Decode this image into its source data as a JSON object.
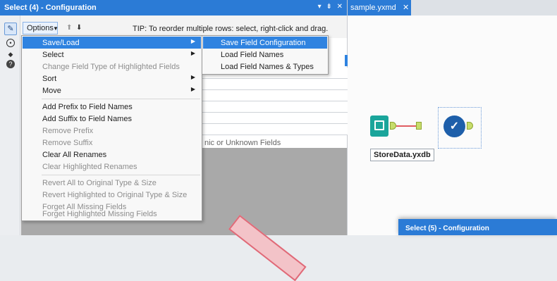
{
  "config_panel": {
    "title": "Select (4) - Configuration",
    "controls": "▾ ⇟ ✕",
    "side_icons": [
      "wrench-icon",
      "target-icon",
      "tag-icon",
      "help-icon"
    ],
    "toolbar": {
      "options_label": "Options",
      "tip": "TIP: To reorder multiple rows: select, right-click and drag."
    },
    "grid_footer": "nic or Unknown Fields"
  },
  "options_menu": {
    "items": [
      {
        "label": "Save/Load",
        "enabled": true,
        "highlighted": true,
        "submenu": true
      },
      {
        "label": "Select",
        "enabled": true,
        "submenu": true
      },
      {
        "label": "Change Field Type of Highlighted Fields",
        "enabled": false
      },
      {
        "label": "Sort",
        "enabled": true,
        "submenu": true
      },
      {
        "label": "Move",
        "enabled": true,
        "submenu": true
      },
      {
        "label": "Add Prefix to Field Names",
        "enabled": true
      },
      {
        "label": "Add Suffix to Field Names",
        "enabled": true
      },
      {
        "label": "Remove Prefix",
        "enabled": false
      },
      {
        "label": "Remove Suffix",
        "enabled": false
      },
      {
        "label": "Clear All Renames",
        "enabled": true
      },
      {
        "label": "Clear Highlighted Renames",
        "enabled": false
      },
      {
        "label": "Revert All to Original Type & Size",
        "enabled": false
      },
      {
        "label": "Revert Highlighted to Original Type & Size",
        "enabled": false
      },
      {
        "label": "Forget All Missing Fields",
        "enabled": false
      },
      {
        "label": "Forget Highlighted Missing Fields",
        "enabled": false
      }
    ]
  },
  "submenu": {
    "items": [
      {
        "label": "Save Field Configuration",
        "highlighted": true
      },
      {
        "label": "Load Field Names"
      },
      {
        "label": "Load Field Names & Types"
      }
    ]
  },
  "canvas": {
    "tab_label": "sample.yxmd",
    "input_tool_label": "StoreData.yxdb",
    "second_window_title": "Select (5) - Configuration"
  },
  "colors": {
    "accent": "#2b7bd6",
    "highlight": "#2f83e0",
    "input_tool": "#1aa59b",
    "select_tool": "#1e5faa",
    "connection": "#e05d62"
  }
}
